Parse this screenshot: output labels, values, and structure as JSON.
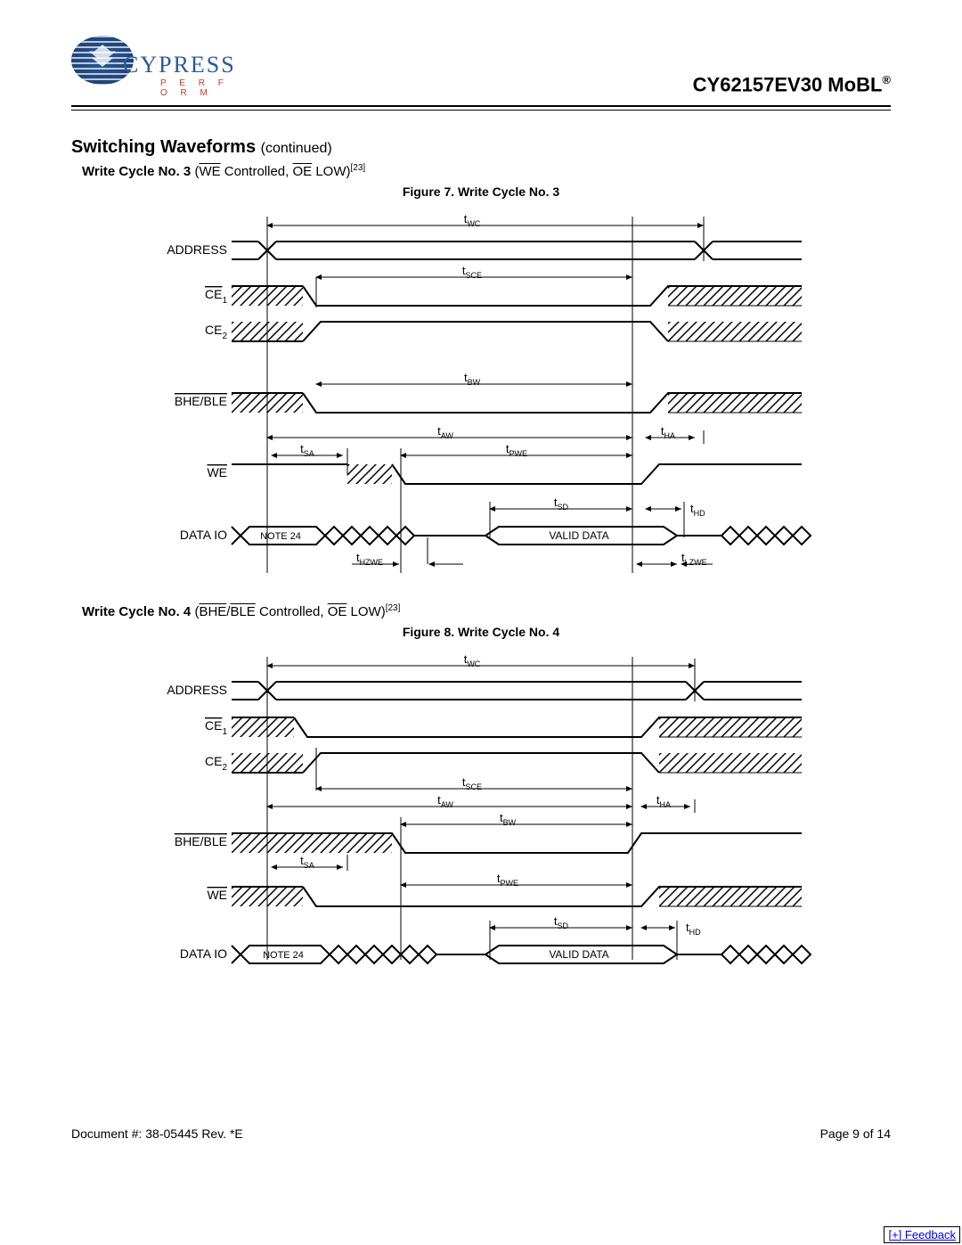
{
  "header": {
    "logo_text": "CYPRESS",
    "logo_subtext": "P E R F O R M",
    "product": "CY62157EV30 MoBL",
    "product_trademark": "®"
  },
  "section": {
    "title": "Switching Waveforms",
    "continued": "(continued)"
  },
  "cycle3": {
    "heading_prefix": "Write Cycle No. 3",
    "heading_detail_open": " (",
    "heading_we": "WE",
    "heading_mid": " Controlled, ",
    "heading_oe": "OE",
    "heading_detail_close": " LOW)",
    "heading_noteref": "[23]",
    "figure_title": "Figure 7. Write Cycle No. 3",
    "signals": {
      "address": "ADDRESS",
      "ce1_bar": "CE",
      "ce1_sub": "1",
      "ce2": "CE",
      "ce2_sub": "2",
      "bhe_ble": "BHE/BLE",
      "we": "WE",
      "dataio": "DATA IO"
    },
    "params": {
      "tWC": "WC",
      "tSCE": "SCE",
      "tBW": "BW",
      "tAW": "AW",
      "tHA": "HA",
      "tSA": "SA",
      "tPWE": "PWE",
      "tSD": "SD",
      "tHD": "HD",
      "tHZWE": "HZWE",
      "tLZWE": "LZWE"
    },
    "note24": "NOTE 24",
    "valid_data": "VALID DATA"
  },
  "cycle4": {
    "heading_prefix": "Write Cycle No. 4",
    "heading_detail_open": " (",
    "heading_bhe": "BHE",
    "heading_slash": "/",
    "heading_ble": "BLE",
    "heading_mid": " Controlled, ",
    "heading_oe": "OE",
    "heading_detail_close": " LOW)",
    "heading_noteref": "[23]",
    "figure_title": "Figure 8. Write Cycle No. 4",
    "signals": {
      "address": "ADDRESS",
      "ce1_bar": "CE",
      "ce1_sub": "1",
      "ce2": "CE",
      "ce2_sub": "2",
      "bhe_ble": "BHE/BLE",
      "we": "WE",
      "dataio": "DATA IO"
    },
    "params": {
      "tWC": "WC",
      "tSCE": "SCE",
      "tBW": "BW",
      "tAW": "AW",
      "tHA": "HA",
      "tSA": "SA",
      "tPWE": "PWE",
      "tSD": "SD",
      "tHD": "HD"
    },
    "note24": "NOTE 24",
    "valid_data": "VALID DATA"
  },
  "footer": {
    "doc": "Document #: 38-05445 Rev. *E",
    "page": "Page 9 of 14"
  },
  "feedback": "[+] Feedback"
}
